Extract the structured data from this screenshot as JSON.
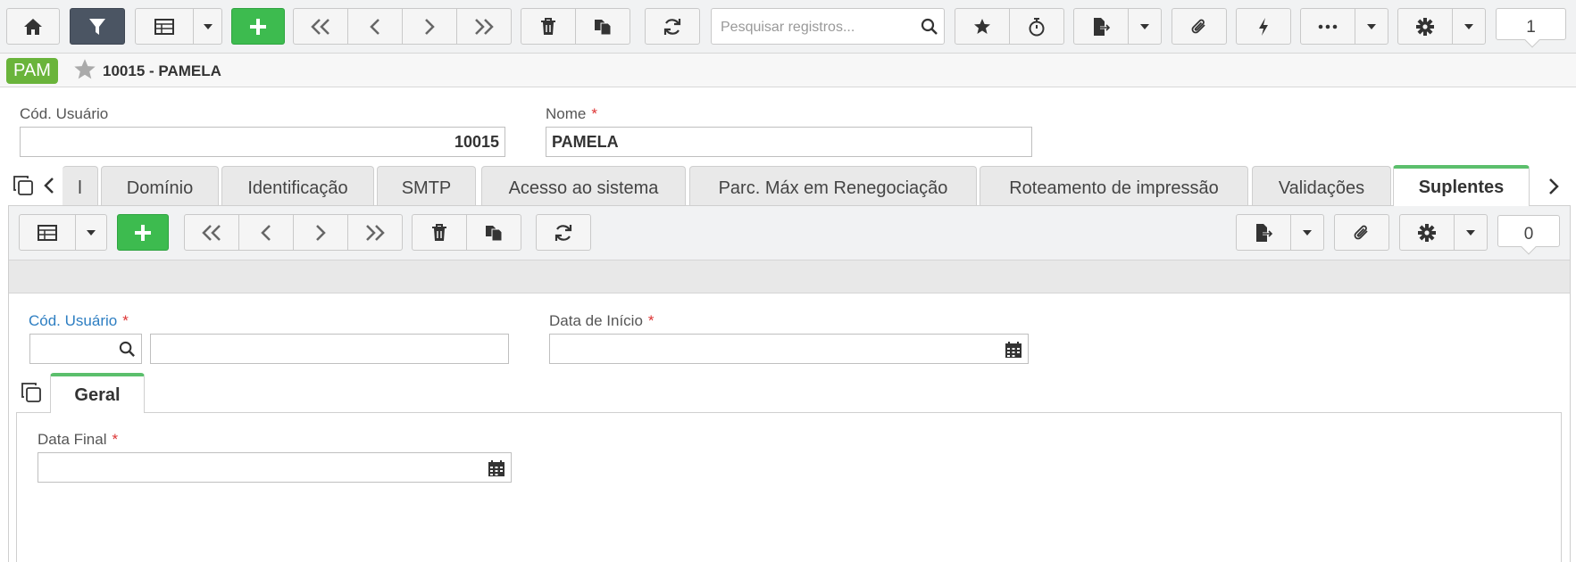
{
  "search": {
    "placeholder": "Pesquisar registros..."
  },
  "toolbar": {
    "record_count": "1"
  },
  "record": {
    "badge": "PAM",
    "title": "10015 - PAMELA"
  },
  "form": {
    "user_code_label": "Cód. Usuário",
    "user_code_value": "10015",
    "name_label": "Nome",
    "name_value": "PAMELA",
    "required_mark": "*"
  },
  "tabs": [
    {
      "label": "l"
    },
    {
      "label": "Domínio"
    },
    {
      "label": "Identificação"
    },
    {
      "label": "SMTP"
    },
    {
      "label": "Acesso ao sistema"
    },
    {
      "label": "Parc. Máx em Renegociação"
    },
    {
      "label": "Roteamento de impressão"
    },
    {
      "label": "Validações"
    },
    {
      "label": "Suplentes"
    }
  ],
  "subtoolbar": {
    "record_count": "0"
  },
  "subform": {
    "user_code_label": "Cód. Usuário",
    "start_date_label": "Data de Início",
    "inner_tab_label": "Geral",
    "end_date_label": "Data Final"
  },
  "colors": {
    "accent_green": "#3dbb4f",
    "badge_green": "#6ab43b",
    "active_tab": "#5bbf6c",
    "link_blue": "#2d7ec2",
    "required_red": "#dd3333"
  }
}
